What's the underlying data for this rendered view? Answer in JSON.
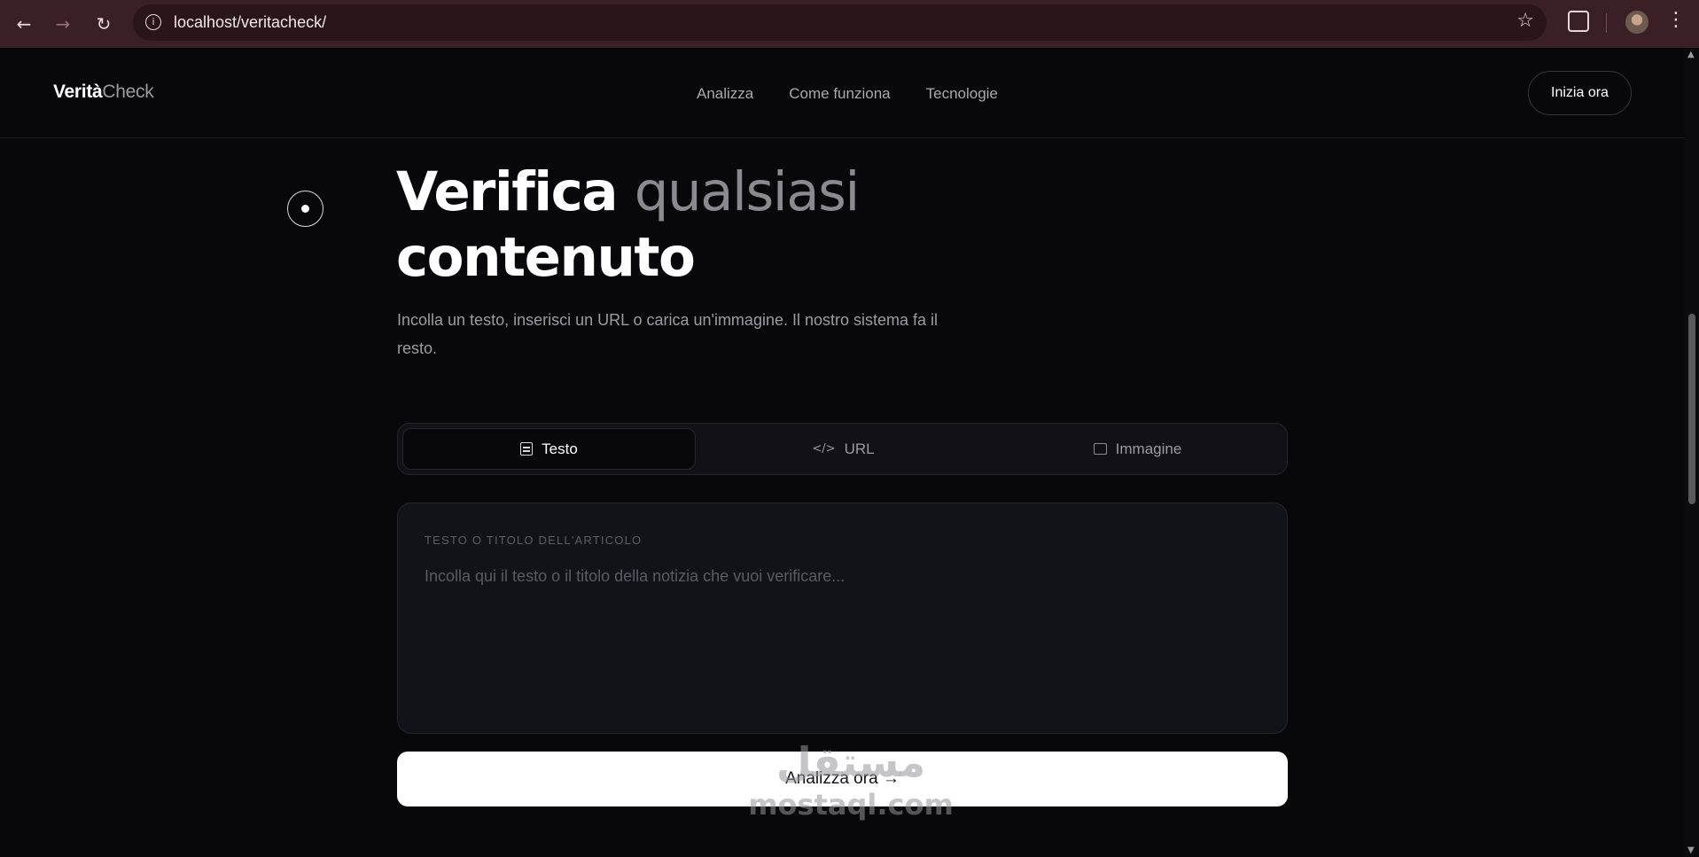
{
  "browser": {
    "url": "localhost/veritacheck/",
    "back_icon": "←",
    "forward_icon": "→",
    "reload_icon": "↻",
    "info_icon": "i",
    "star_icon": "☆",
    "menu_icon": "⋮"
  },
  "header": {
    "logo_bold": "Verità",
    "logo_light": "Check",
    "nav": [
      "Analizza",
      "Come funziona",
      "Tecnologie"
    ],
    "cta_label": "Inizia ora"
  },
  "hero": {
    "title_part1": "Verifica ",
    "title_part2": "qualsiasi",
    "title_line2": "contenuto",
    "subtitle": "Incolla un testo, inserisci un URL o carica un'immagine. Il nostro sistema fa il resto."
  },
  "tabs": [
    {
      "label": "Testo",
      "icon": "document-icon",
      "active": true
    },
    {
      "label": "URL",
      "icon": "code-icon",
      "active": false
    },
    {
      "label": "Immagine",
      "icon": "image-icon",
      "active": false
    }
  ],
  "input": {
    "label": "TESTO O TITOLO DELL'ARTICOLO",
    "placeholder": "Incolla qui il testo o il titolo della notizia che vuoi verificare...",
    "value": ""
  },
  "submit_label": "Analizza ora →",
  "watermark": {
    "arabic": "مستقل",
    "latin": "mostaql.com"
  },
  "colors": {
    "background": "#08080b",
    "chrome": "#3b1f26",
    "accent": "#ffffff",
    "muted": "#8a8a90"
  }
}
